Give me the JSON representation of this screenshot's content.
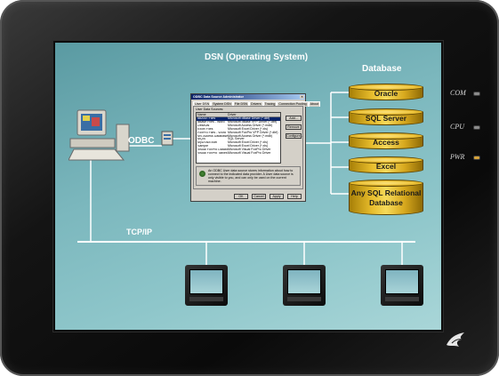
{
  "diagram": {
    "database_title": "Database",
    "dsn_title": "DSN (Operating System)",
    "odbc_label": "ODBC",
    "network_label": "TCP/IP",
    "databases": [
      "Oracle",
      "SQL Server",
      "Access",
      "Excel"
    ],
    "database_big": {
      "line1": "Any SQL Relational",
      "line2": "Database"
    }
  },
  "odbc_dialog": {
    "title": "ODBC Data Source Administrator",
    "tabs": [
      "User DSN",
      "System DSN",
      "File DSN",
      "Drivers",
      "Tracing",
      "Connection Pooling",
      "About"
    ],
    "subtitle": "User Data Sources:",
    "columns": [
      "Name",
      "Driver"
    ],
    "rows": [
      [
        "dBASE Files",
        "Microsoft dBase Driver (*.dbf)"
      ],
      [
        "dBase Files - Word",
        "Microsoft dBase VFP Driver (*.dbf)"
      ],
      [
        "DeltaVal",
        "Microsoft Access Driver (*.mdb)"
      ],
      [
        "Excel Files",
        "Microsoft Excel Driver (*.xls)"
      ],
      [
        "FoxPro Files - Word",
        "Microsoft FoxPro VFP Driver (*.dbf)"
      ],
      [
        "MS Access Database",
        "Microsoft Access Driver (*.mdb)"
      ],
      [
        "MQIS",
        "SQL Server"
      ],
      [
        "MyDSN/Excel",
        "Microsoft Excel Driver (*.xls)"
      ],
      [
        "Sample",
        "Microsoft Excel Driver (*.xls)"
      ],
      [
        "Visual FoxPro Database",
        "Microsoft Visual FoxPro Driver"
      ],
      [
        "Visual FoxPro Tables",
        "Microsoft Visual FoxPro Driver"
      ]
    ],
    "buttons": [
      "Add...",
      "Remove",
      "Configure..."
    ],
    "info": "An ODBC User data source stores information about how to connect to the indicated data provider. A User data source is only visible to you, and can only be used on the current machine.",
    "footer": [
      "OK",
      "Cancel",
      "Apply",
      "Help"
    ]
  },
  "indicators": [
    "COM",
    "CPU",
    "PWR"
  ],
  "colors": {
    "screen": "#7bb7bd",
    "cylinder": "#e7bc2b",
    "line": "#ffffff",
    "bezel": "#141414",
    "pwr_led": "#d6a33a"
  }
}
